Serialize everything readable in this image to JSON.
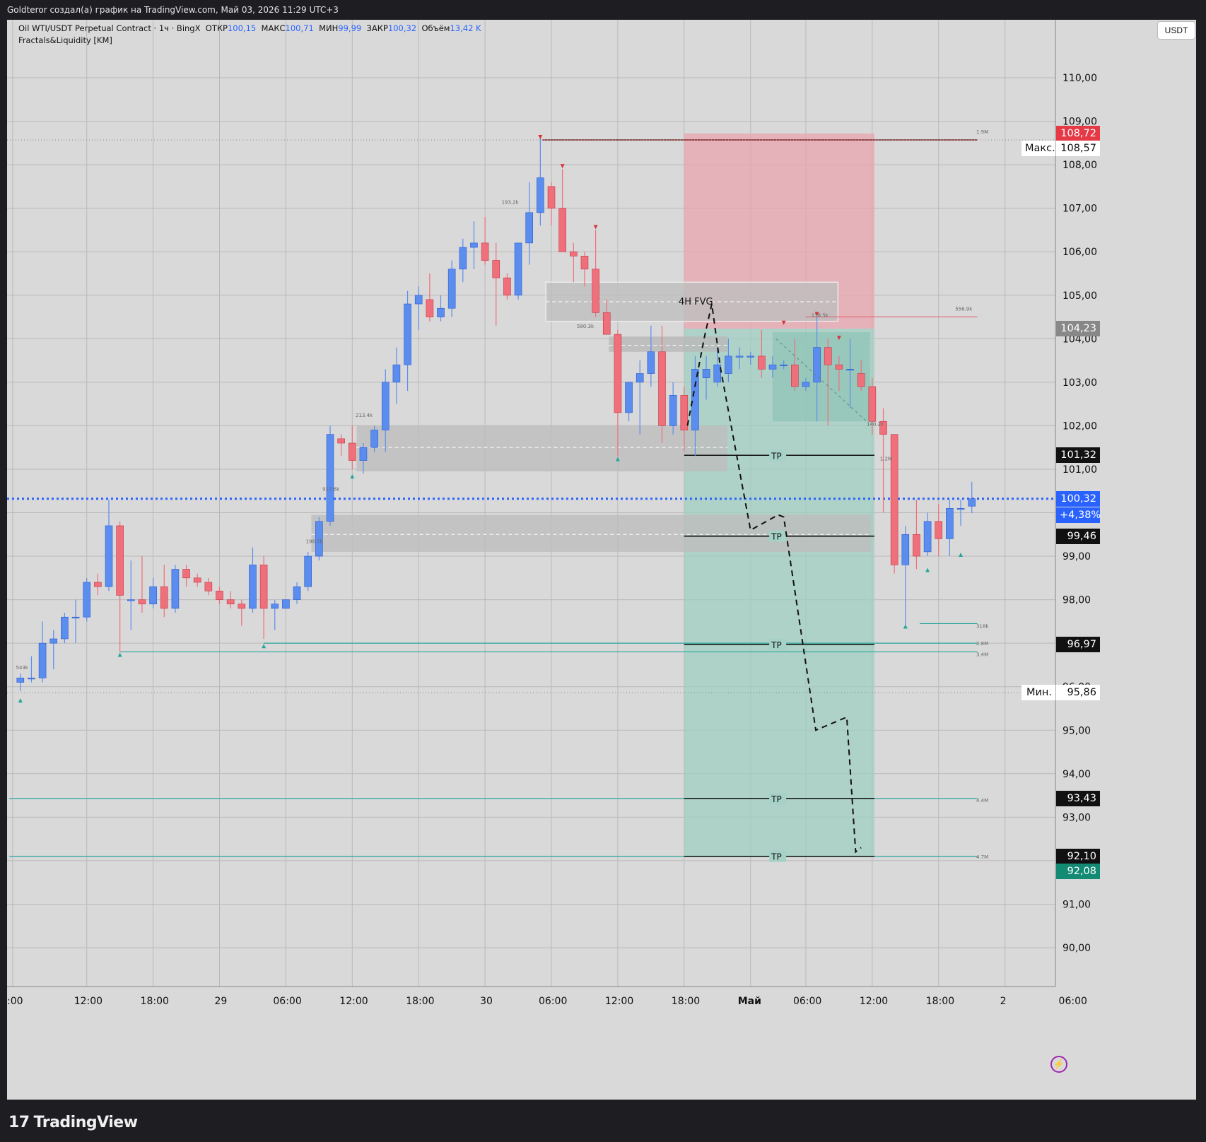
{
  "header": {
    "text": "Goldteror создал(а) график на TradingView.com, Май 03, 2026 11:29 UTC+3"
  },
  "legend": {
    "symbol": "Oil WTI/USDT Perpetual Contract · 1ч · BingX",
    "open_label": "ОТКР",
    "open": "100,15",
    "high_label": "МАКС",
    "high": "100,71",
    "low_label": "МИН",
    "low": "99,99",
    "close_label": "ЗАКР",
    "close": "100,32",
    "volume_label": "Объём",
    "volume": "13,42 K",
    "indicator": "Fractals&Liquidity [KM]"
  },
  "currency": "USDT",
  "footer": {
    "brand": "TradingView"
  },
  "colors": {
    "bull": "#5b8def",
    "bear": "#ef6f7a",
    "sl_zone": "#e8a4ad",
    "tp_zone": "#9fcdc1",
    "last_price": "#2962ff",
    "teal": "#26a69a",
    "maroon": "#7b1e1e"
  },
  "chart_data": {
    "type": "candlestick",
    "y_ticks": [
      "110,00",
      "109,00",
      "108,00",
      "107,00",
      "106,00",
      "105,00",
      "104,00",
      "103,00",
      "102,00",
      "101,00",
      "100,00",
      "99,00",
      "98,00",
      "97,00",
      "96,00",
      "95,00",
      "94,00",
      "93,00",
      "92,00",
      "91,00",
      "90,00"
    ],
    "y_tick_values": [
      110,
      109,
      108,
      107,
      106,
      105,
      104,
      103,
      102,
      101,
      100,
      99,
      98,
      97,
      96,
      95,
      94,
      93,
      92,
      91,
      90
    ],
    "x_ticks": [
      ":00",
      "12:00",
      "18:00",
      "29",
      "06:00",
      "12:00",
      "18:00",
      "30",
      "06:00",
      "12:00",
      "18:00",
      "Май",
      "06:00",
      "12:00",
      "18:00",
      "2",
      "06:00"
    ],
    "x_tick_index": [
      -0.7,
      6,
      12,
      18,
      24,
      30,
      36,
      42,
      48,
      54,
      60,
      66,
      71,
      77,
      83,
      89,
      95
    ],
    "candles": [
      [
        96.1,
        96.3,
        95.9,
        96.2
      ],
      [
        96.2,
        96.7,
        96.1,
        96.2
      ],
      [
        96.2,
        97.5,
        96.1,
        97.0
      ],
      [
        97.0,
        97.3,
        96.4,
        97.1
      ],
      [
        97.1,
        97.7,
        97.0,
        97.6
      ],
      [
        97.6,
        98.0,
        97.0,
        97.6
      ],
      [
        97.6,
        98.5,
        97.5,
        98.4
      ],
      [
        98.4,
        98.6,
        98.1,
        98.3
      ],
      [
        98.3,
        100.3,
        98.2,
        99.7
      ],
      [
        99.7,
        99.8,
        96.8,
        98.1
      ],
      [
        98.0,
        98.9,
        97.3,
        98.0
      ],
      [
        98.0,
        99.0,
        97.7,
        97.9
      ],
      [
        97.9,
        98.5,
        97.8,
        98.3
      ],
      [
        98.3,
        98.8,
        97.6,
        97.8
      ],
      [
        97.8,
        98.8,
        97.7,
        98.7
      ],
      [
        98.7,
        98.8,
        98.3,
        98.5
      ],
      [
        98.5,
        98.6,
        98.3,
        98.4
      ],
      [
        98.4,
        98.5,
        98.1,
        98.2
      ],
      [
        98.2,
        98.3,
        97.9,
        98.0
      ],
      [
        98.0,
        98.2,
        97.8,
        97.9
      ],
      [
        97.9,
        98.0,
        97.4,
        97.8
      ],
      [
        97.8,
        99.2,
        97.7,
        98.8
      ],
      [
        98.8,
        99.0,
        97.1,
        97.8
      ],
      [
        97.8,
        98.0,
        97.3,
        97.9
      ],
      [
        97.8,
        98.0,
        97.8,
        98.0
      ],
      [
        98.0,
        98.4,
        97.9,
        98.3
      ],
      [
        98.3,
        99.1,
        98.2,
        99.0
      ],
      [
        99.0,
        99.9,
        98.9,
        99.8
      ],
      [
        99.8,
        102.0,
        99.7,
        101.8
      ],
      [
        101.7,
        101.8,
        101.3,
        101.6
      ],
      [
        101.6,
        102.0,
        101.0,
        101.2
      ],
      [
        101.2,
        101.6,
        100.9,
        101.5
      ],
      [
        101.5,
        102.0,
        101.4,
        101.9
      ],
      [
        101.9,
        103.3,
        101.4,
        103.0
      ],
      [
        103.0,
        103.8,
        102.5,
        103.4
      ],
      [
        103.4,
        105.1,
        102.8,
        104.8
      ],
      [
        104.8,
        105.2,
        104.2,
        105.0
      ],
      [
        104.9,
        105.5,
        104.4,
        104.5
      ],
      [
        104.5,
        105.0,
        104.4,
        104.7
      ],
      [
        104.7,
        105.8,
        104.5,
        105.6
      ],
      [
        105.6,
        106.3,
        105.3,
        106.1
      ],
      [
        106.1,
        106.7,
        105.6,
        106.2
      ],
      [
        106.2,
        106.8,
        105.7,
        105.8
      ],
      [
        105.8,
        106.2,
        104.3,
        105.4
      ],
      [
        105.4,
        105.5,
        104.9,
        105.0
      ],
      [
        105.0,
        106.2,
        104.9,
        106.2
      ],
      [
        106.2,
        107.6,
        105.7,
        106.9
      ],
      [
        106.9,
        108.6,
        106.6,
        107.7
      ],
      [
        107.5,
        107.6,
        106.6,
        107.0
      ],
      [
        107.0,
        107.9,
        106.0,
        106.0
      ],
      [
        106.0,
        106.2,
        105.3,
        105.9
      ],
      [
        105.9,
        106.0,
        105.2,
        105.6
      ],
      [
        105.6,
        106.5,
        104.5,
        104.6
      ],
      [
        104.6,
        104.9,
        104.1,
        104.1
      ],
      [
        104.1,
        104.2,
        101.3,
        102.3
      ],
      [
        102.3,
        103.0,
        102.1,
        103.0
      ],
      [
        103.0,
        103.5,
        101.8,
        103.2
      ],
      [
        103.2,
        104.3,
        102.9,
        103.7
      ],
      [
        103.7,
        104.3,
        101.6,
        102.0
      ],
      [
        102.0,
        103.0,
        101.8,
        102.7
      ],
      [
        102.7,
        102.9,
        101.4,
        101.9
      ],
      [
        101.9,
        103.6,
        101.3,
        103.3
      ],
      [
        103.1,
        103.6,
        102.6,
        103.3
      ],
      [
        103.0,
        103.8,
        102.9,
        103.4
      ],
      [
        103.2,
        104.0,
        103.0,
        103.6
      ],
      [
        103.6,
        103.8,
        103.3,
        103.6
      ],
      [
        103.6,
        103.7,
        103.4,
        103.6
      ],
      [
        103.6,
        104.2,
        103.1,
        103.3
      ],
      [
        103.3,
        103.6,
        103.1,
        103.4
      ],
      [
        103.4,
        103.5,
        103.3,
        103.4
      ],
      [
        103.4,
        104.0,
        102.8,
        102.9
      ],
      [
        102.9,
        103.1,
        102.8,
        103.0
      ],
      [
        103.0,
        104.5,
        102.1,
        103.8
      ],
      [
        103.8,
        104.0,
        102.0,
        103.4
      ],
      [
        103.4,
        103.6,
        102.8,
        103.3
      ],
      [
        103.3,
        104.0,
        102.4,
        103.3
      ],
      [
        103.2,
        103.5,
        102.8,
        102.9
      ],
      [
        102.9,
        103.1,
        101.8,
        102.1
      ],
      [
        102.1,
        102.4,
        100.0,
        101.8
      ],
      [
        101.8,
        101.8,
        98.6,
        98.8
      ],
      [
        98.8,
        99.7,
        97.4,
        99.5
      ],
      [
        99.5,
        100.3,
        98.7,
        99.0
      ],
      [
        99.1,
        100.0,
        99.0,
        99.8
      ],
      [
        99.8,
        100.2,
        99.0,
        99.4
      ],
      [
        99.4,
        100.3,
        99.0,
        100.1
      ],
      [
        100.1,
        100.3,
        99.7,
        100.1
      ],
      [
        100.15,
        100.71,
        99.99,
        100.32
      ]
    ],
    "volume_labels": [
      "543k",
      "213.4k",
      "917.6k",
      "196.7k",
      "193.2k",
      "580.3k",
      "138.5k",
      "140.2k",
      "556.9k",
      "1.9M",
      "1.2M",
      "318k",
      "2.8M",
      "3.4M",
      "4.4M",
      "4.7M"
    ],
    "annotations": {
      "fvg": "4H FVG",
      "tp": "TP",
      "max_label": "Макс.",
      "min_label": "Мин."
    },
    "tp_levels": [
      101.32,
      99.46,
      96.97,
      93.43,
      92.1
    ],
    "price_labels": {
      "sl": "108,72",
      "max_top": "108,57",
      "max": "108,57",
      "entry": "104,23",
      "tp1": "101,32",
      "last": "100,32",
      "change": "+4,38%",
      "tp2": "99,46",
      "tp3": "96,97",
      "min": "95,86",
      "tp4": "93,43",
      "tp5": "92,10",
      "target": "92,08"
    }
  }
}
